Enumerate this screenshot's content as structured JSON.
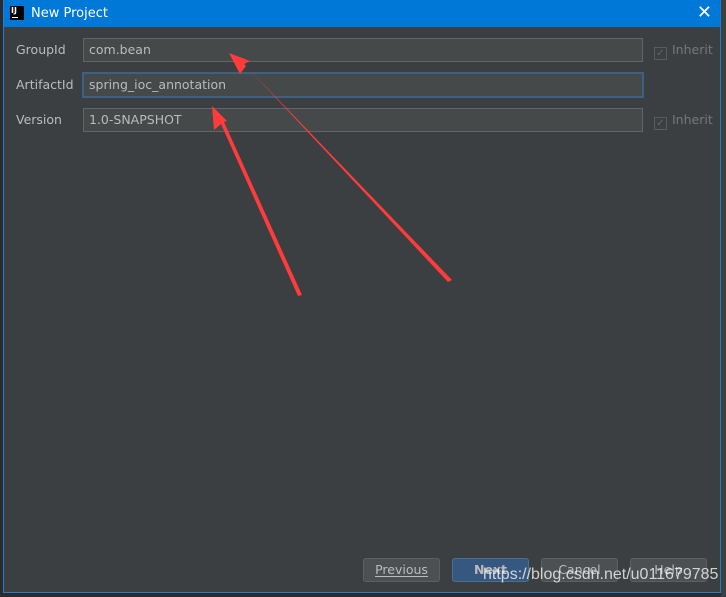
{
  "dialog": {
    "title": "New Project",
    "logo_text": "IJ",
    "close_icon": "close-icon"
  },
  "form": {
    "group_id": {
      "label": "GroupId",
      "value": "com.bean",
      "inherit_label": "Inherit",
      "inherit_checked": true
    },
    "artifact_id": {
      "label": "ArtifactId",
      "value": "spring_ioc_annotation"
    },
    "version": {
      "label": "Version",
      "value": "1.0-SNAPSHOT",
      "inherit_label": "Inherit",
      "inherit_checked": true
    }
  },
  "buttons": {
    "previous": "Previous",
    "next": "Next",
    "cancel": "Cancel",
    "help": "Help"
  },
  "annotations": {
    "arrow_color": "#ff3b3b"
  },
  "watermark": "https://blog.csdn.net/u011679785",
  "colors": {
    "titlebar": "#0078d7",
    "background": "#3c3f41",
    "primary_button": "#365880"
  }
}
